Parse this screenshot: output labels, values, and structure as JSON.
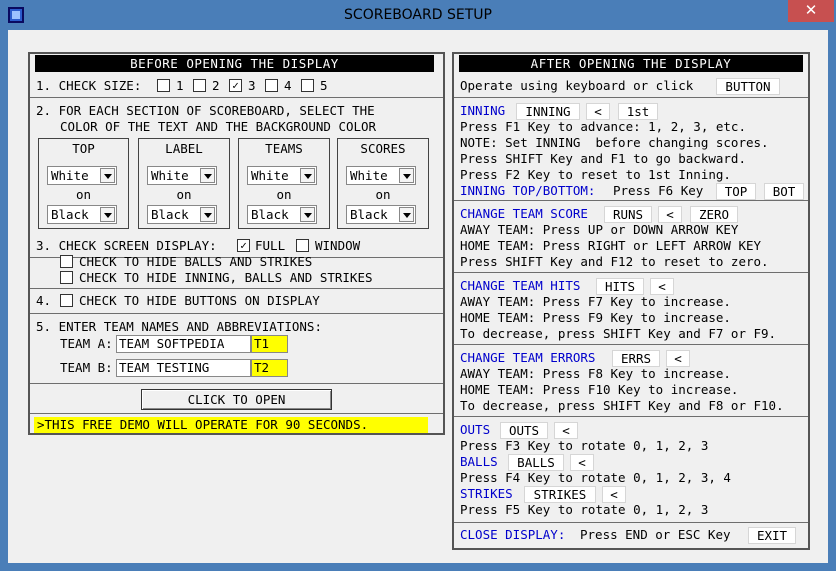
{
  "window": {
    "title": "SCOREBOARD SETUP",
    "close": "✕"
  },
  "left": {
    "header": "BEFORE OPENING THE DISPLAY",
    "check_size": {
      "label": "1. CHECK SIZE:",
      "options": [
        "1",
        "2",
        "3",
        "4",
        "5"
      ],
      "checked": "3"
    },
    "section2": {
      "line1": "2. FOR EACH SECTION OF SCOREBOARD, SELECT THE",
      "line2": "COLOR OF THE TEXT AND THE BACKGROUND COLOR",
      "on": "on",
      "columns": [
        {
          "title": "TOP",
          "text": "White",
          "bg": "Black"
        },
        {
          "title": "LABEL",
          "text": "White",
          "bg": "Black"
        },
        {
          "title": "TEAMS",
          "text": "White",
          "bg": "Black"
        },
        {
          "title": "SCORES",
          "text": "White",
          "bg": "Black"
        }
      ]
    },
    "section3": {
      "label": "3. CHECK SCREEN DISPLAY:",
      "full": "FULL",
      "window": "WINDOW",
      "hide_balls": "CHECK TO HIDE BALLS AND STRIKES",
      "hide_inning": "CHECK TO HIDE INNING, BALLS AND STRIKES",
      "full_checked": true
    },
    "section4": {
      "prefix": "4.",
      "label": "CHECK TO HIDE BUTTONS ON DISPLAY"
    },
    "section5": {
      "label": "5. ENTER TEAM NAMES AND ABBREVIATIONS:",
      "team_a_label": "TEAM A:",
      "team_a_name": "TEAM SOFTPEDIA",
      "team_a_abbr": "T1",
      "team_b_label": "TEAM B:",
      "team_b_name": "TEAM TESTING",
      "team_b_abbr": "T2"
    },
    "open_button": "CLICK TO OPEN",
    "demo": ">THIS FREE DEMO WILL OPERATE FOR 90 SECONDS."
  },
  "right": {
    "header": "AFTER OPENING THE DISPLAY",
    "operate": "Operate using keyboard or click",
    "operate_btn": "BUTTON",
    "inning": {
      "label": "INNING",
      "btn": "INNING",
      "back": "<",
      "value": "1st",
      "l1": "Press F1 Key to advance: 1, 2, 3, etc.",
      "l2": "NOTE: Set INNING  before changing scores.",
      "l3": "Press SHIFT Key and F1 to go backward.",
      "l4": "Press F2 Key to reset to 1st Inning.",
      "topbot_label": "INNING TOP/BOTTOM:",
      "topbot_text": "Press F6 Key",
      "top": "TOP",
      "bot": "BOT"
    },
    "score": {
      "label": "CHANGE TEAM SCORE",
      "btn": "RUNS",
      "back": "<",
      "zero": "ZERO",
      "l1": "AWAY TEAM: Press UP or DOWN ARROW KEY",
      "l2": "HOME TEAM: Press RIGHT or LEFT ARROW KEY",
      "l3": "Press SHIFT Key and F12 to reset to zero."
    },
    "hits": {
      "label": "CHANGE TEAM HITS",
      "btn": "HITS",
      "back": "<",
      "l1": "AWAY TEAM: Press F7 Key to increase.",
      "l2": "HOME TEAM: Press F9 Key to increase.",
      "l3": "To decrease, press SHIFT Key and F7 or F9."
    },
    "errors": {
      "label": "CHANGE TEAM ERRORS",
      "btn": "ERRS",
      "back": "<",
      "l1": "AWAY TEAM: Press F8 Key to increase.",
      "l2": "HOME TEAM: Press F10 Key to increase.",
      "l3": "To decrease, press SHIFT Key and F8 or F10."
    },
    "counts": {
      "outs_label": "OUTS",
      "outs_btn": "OUTS",
      "outs_text": "Press F3 Key to rotate 0, 1, 2, 3",
      "balls_label": "BALLS",
      "balls_btn": "BALLS",
      "balls_text": "Press F4 Key to rotate 0, 1, 2, 3, 4",
      "strikes_label": "STRIKES",
      "strikes_btn": "STRIKES",
      "strikes_text": "Press F5 Key to rotate 0, 1, 2, 3",
      "back": "<"
    },
    "close": {
      "label": "CLOSE DISPLAY:",
      "text": "Press END or ESC Key",
      "btn": "EXIT"
    }
  }
}
